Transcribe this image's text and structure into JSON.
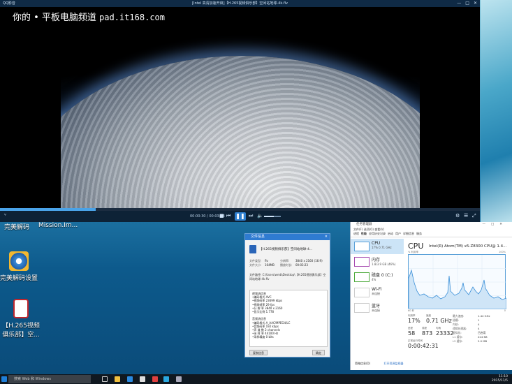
{
  "player": {
    "app_name": "QQ影音",
    "title": "[Intel 高清加速开启]【H.265视频俱乐部】空间站地球-4k.flv",
    "time": "00:00:30 / 00:03:23",
    "seek_fraction": 0.2,
    "volume_fraction": 0.6
  },
  "watermark": {
    "text": "你的 • 平板电脑频道",
    "domain": "pad.it168.com"
  },
  "desktop_icons": [
    {
      "label": "完美解码",
      "icon": "wmp-icon"
    },
    {
      "label": "Mission.Im...",
      "icon": "mission-icon"
    },
    {
      "label": "完美解码设置",
      "icon": "settings-gear-icon"
    },
    {
      "label": "【H.265视频",
      "label2": "俱乐部】空...",
      "icon": "flv-file-icon"
    }
  ],
  "file_info": {
    "title": "文件信息",
    "file_name": "【H.265视频俱乐部】空间站地球-4...",
    "fields": [
      {
        "k": "文件类型:",
        "v": "flv"
      },
      {
        "k": "文件大小:",
        "v": "164MB"
      },
      {
        "k": "分辨率:",
        "v": "3840 x 2160 (16:9)"
      },
      {
        "k": "播放时长:",
        "v": "00:03:23"
      }
    ],
    "path_label": "文件路径:",
    "path": "C:\\Users\\wmb\\Desktop\\【H.265视频俱乐部】空间站地球-4k.flv",
    "video_lines": [
      "视频流信息",
      "•编码格式  AVC",
      "•视频码率  23699 kbps",
      "•视频帧率  29 fps",
      "•分 辨 率  3840 x 2160",
      "•显示比例  1.778"
    ],
    "audio_lines": [
      "音频流信息",
      "•编码格式  A_AAC/MPEG4/LC",
      "•音频码率  192 kbps",
      "•声 道 数  2 channels",
      "•采 样 率  44100 Hz",
      "•采样精度  0 bits"
    ],
    "copy_button": "复制信息",
    "ok_button": "确定"
  },
  "task_manager": {
    "title": "任务管理器",
    "menu": "文件(F)  选项(O)  查看(V)",
    "tabs": [
      "进程",
      "性能",
      "应用历史记录",
      "启动",
      "用户",
      "详细信息",
      "服务"
    ],
    "side_items": [
      {
        "name": "CPU",
        "value": "17% 0.71 GHz"
      },
      {
        "name": "内存",
        "value": "1.8/3.9 GB (46%)"
      },
      {
        "name": "磁盘 0 (C:)",
        "value": "4%"
      },
      {
        "name": "Wi-Fi",
        "value": "未连接"
      },
      {
        "name": "蓝牙",
        "value": "未连接"
      }
    ],
    "cpu_heading": "CPU",
    "cpu_name": "Intel(R) Atom(TM) x5-Z8300 CPU@ 1.4...",
    "graph_label": "% 利用率",
    "graph_max": "100%",
    "graph_time": "60 秒",
    "graph_zero": "0",
    "stats": {
      "util_label": "利用率",
      "util": "17%",
      "speed_label": "速度",
      "speed": "0.71 GHz",
      "proc_label": "进程",
      "proc": "58",
      "thread_label": "线程",
      "thread": "873",
      "handle_label": "句柄",
      "handle": "23332",
      "uptime_label": "正常运行时间",
      "uptime": "0:00:42:31"
    },
    "specs": [
      {
        "k": "最大速度:",
        "v": "1.44 GHz"
      },
      {
        "k": "插槽:",
        "v": "1"
      },
      {
        "k": "内核:",
        "v": "4"
      },
      {
        "k": "逻辑处理器:",
        "v": "4"
      },
      {
        "k": "虚拟化:",
        "v": "已启用"
      },
      {
        "k": "L1 缓存:",
        "v": "224 KB"
      },
      {
        "k": "L2 缓存:",
        "v": "2.0 MB"
      }
    ],
    "footer_brief": "简略信息(D)",
    "footer_link": "打开资源监视器"
  },
  "taskbar": {
    "search_placeholder": "搜索 Web 和 Windows",
    "time": "11:10",
    "date": "2015/11/5"
  },
  "colors": {
    "accent": "#2f7bd1",
    "player_bg": "#0d2236"
  }
}
